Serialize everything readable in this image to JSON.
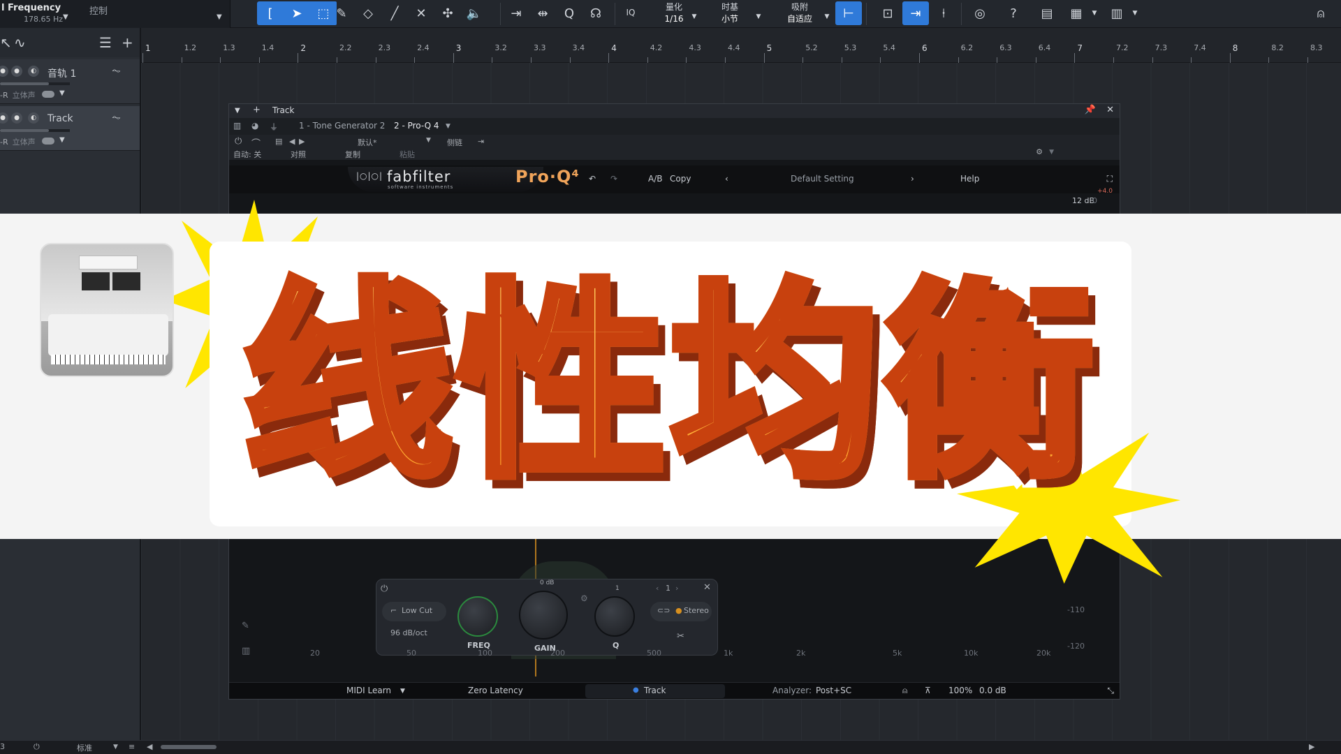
{
  "toolbar": {
    "freq_title": "l Frequency",
    "freq_value": "178.65 Hz",
    "control_label": "控制",
    "iq_label": "IQ",
    "quantize_label": "量化",
    "quantize_value": "1/16",
    "timebase_label": "时基",
    "timebase_value": "小节",
    "snap_label": "吸附",
    "snap_value": "自适应",
    "help_label": "?"
  },
  "tracks": [
    {
      "name": "音轨 1",
      "io": "-R",
      "pan": "立体声"
    },
    {
      "name": "Track",
      "io": "-R",
      "pan": "立体声"
    }
  ],
  "ruler": {
    "labels": [
      "1",
      "1.2",
      "1.3",
      "1.4",
      "2",
      "2.2",
      "2.3",
      "2.4",
      "3",
      "3.2",
      "3.3",
      "3.4",
      "4",
      "4.2",
      "4.3",
      "4.4",
      "5",
      "5.2",
      "5.3",
      "5.4",
      "6",
      "6.2",
      "6.3",
      "6.4",
      "7",
      "7.2",
      "7.3",
      "7.4",
      "8",
      "8.2",
      "8.3"
    ]
  },
  "plugin": {
    "window_title": "Track",
    "tab1": "1 - Tone Generator 2",
    "tab2": "2 - Pro-Q 4",
    "preset_default": "默认*",
    "sidechain": "侧链",
    "auto_off": "自动: 关",
    "compare": "对照",
    "copy_cn": "复制",
    "paste_cn": "粘贴",
    "brand": "fabfilter",
    "brand_sub": "software instruments",
    "product": "Pro·Q⁴",
    "ab_label": "A/B",
    "copy_label": "Copy",
    "preset_name": "Default Setting",
    "help_label": "Help",
    "db_range": "12 dB",
    "db_zero": "0",
    "gain_readout": "+4.0",
    "band": {
      "filter_type": "Low Cut",
      "slope": "96 dB/oct",
      "freq_label": "FREQ",
      "gain_label": "GAIN",
      "gain_value": "0 dB",
      "q_label": "Q",
      "q_value": "1",
      "band_index": "1",
      "stereo_label": "Stereo"
    },
    "freq_axis": [
      "20",
      "50",
      "100",
      "200",
      "500",
      "1k",
      "2k",
      "5k",
      "10k",
      "20k"
    ],
    "db_axis": [
      "-110",
      "-120"
    ],
    "footer": {
      "midi_learn": "MIDI Learn",
      "latency": "Zero Latency",
      "track": "Track",
      "analyzer_label": "Analyzer:",
      "analyzer_value": "Post+SC",
      "zoom": "100%",
      "output_gain": "0.0 dB"
    }
  },
  "banner": {
    "title": "线性均衡"
  },
  "status": {
    "mode": "标准"
  },
  "colors": {
    "accent": "#2f7ad9",
    "title_fill": "#ffbe3c",
    "title_stroke": "#c8410e",
    "burst": "#ffe600",
    "proq_orange": "#f0a45a"
  }
}
